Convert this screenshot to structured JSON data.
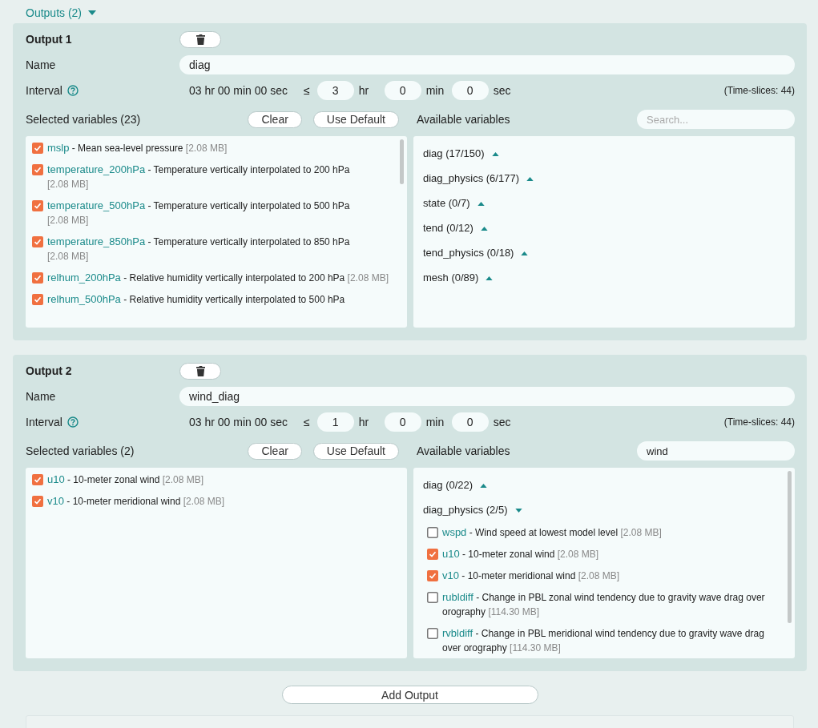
{
  "outputs_header": {
    "label": "Outputs (2)",
    "expanded": true
  },
  "outputs": [
    {
      "title": "Output 1",
      "name_label": "Name",
      "name": "diag",
      "interval_label": "Interval",
      "interval_text": "03 hr 00 min 00 sec",
      "leq": "≤",
      "hr": "3",
      "hr_unit": "hr",
      "min": "0",
      "min_unit": "min",
      "sec": "0",
      "sec_unit": "sec",
      "time_slices": "(Time-slices: 44)",
      "selected_label": "Selected variables (23)",
      "clear": "Clear",
      "use_default": "Use Default",
      "available_label": "Available variables",
      "search": {
        "placeholder": "Search..."
      },
      "selected_scrollbar": true,
      "available_scrollbar": false,
      "selected": [
        {
          "checked": true,
          "name": "mslp",
          "description": "- Mean sea-level pressure",
          "size": "[2.08 MB]"
        },
        {
          "checked": true,
          "name": "temperature_200hPa",
          "description": "- Temperature vertically interpolated to 200 hPa",
          "size": "[2.08 MB]"
        },
        {
          "checked": true,
          "name": "temperature_500hPa",
          "description": "- Temperature vertically interpolated to 500 hPa",
          "size": "[2.08 MB]"
        },
        {
          "checked": true,
          "name": "temperature_850hPa",
          "description": "- Temperature vertically interpolated to 850 hPa",
          "size": "[2.08 MB]"
        },
        {
          "checked": true,
          "name": "relhum_200hPa",
          "description": "- Relative humidity vertically interpolated to 200 hPa",
          "size": "[2.08 MB]"
        },
        {
          "checked": true,
          "name": "relhum_500hPa",
          "description": "- Relative humidity vertically interpolated to 500 hPa"
        }
      ],
      "groups": [
        {
          "label": "diag (17/150)",
          "expanded": false
        },
        {
          "label": "diag_physics (6/177)",
          "expanded": false
        },
        {
          "label": "state (0/7)",
          "expanded": false
        },
        {
          "label": "tend (0/12)",
          "expanded": false
        },
        {
          "label": "tend_physics (0/18)",
          "expanded": false
        },
        {
          "label": "mesh (0/89)",
          "expanded": false
        }
      ]
    },
    {
      "title": "Output 2",
      "name_label": "Name",
      "name": "wind_diag",
      "interval_label": "Interval",
      "interval_text": "03 hr 00 min 00 sec",
      "leq": "≤",
      "hr": "1",
      "hr_unit": "hr",
      "min": "0",
      "min_unit": "min",
      "sec": "0",
      "sec_unit": "sec",
      "time_slices": "(Time-slices: 44)",
      "selected_label": "Selected variables (2)",
      "clear": "Clear",
      "use_default": "Use Default",
      "available_label": "Available variables",
      "search": {
        "value": "wind"
      },
      "selected_scrollbar": false,
      "available_scrollbar": true,
      "selected": [
        {
          "checked": true,
          "name": "u10",
          "description": "- 10-meter zonal wind",
          "size": "[2.08 MB]"
        },
        {
          "checked": true,
          "name": "v10",
          "description": "- 10-meter meridional wind",
          "size": "[2.08 MB]"
        }
      ],
      "groups": [
        {
          "label": "diag (0/22)",
          "expanded": false
        },
        {
          "label": "diag_physics (2/5)",
          "expanded": true,
          "children": [
            {
              "checked": false,
              "name": "wspd",
              "description": "- Wind speed at lowest model level",
              "size": "[2.08 MB]"
            },
            {
              "checked": true,
              "name": "u10",
              "description": "- 10-meter zonal wind",
              "size": "[2.08 MB]"
            },
            {
              "checked": true,
              "name": "v10",
              "description": "- 10-meter meridional wind",
              "size": "[2.08 MB]"
            },
            {
              "checked": false,
              "name": "rubldiff",
              "description": "- Change in PBL zonal wind tendency due to gravity wave drag over orography",
              "size": "[114.30 MB]"
            },
            {
              "checked": false,
              "name": "rvbldiff",
              "description": "- Change in PBL meridional wind tendency due to gravity wave drag over orography",
              "size": "[114.30 MB]"
            }
          ]
        }
      ]
    }
  ],
  "add_output": "Add Output"
}
